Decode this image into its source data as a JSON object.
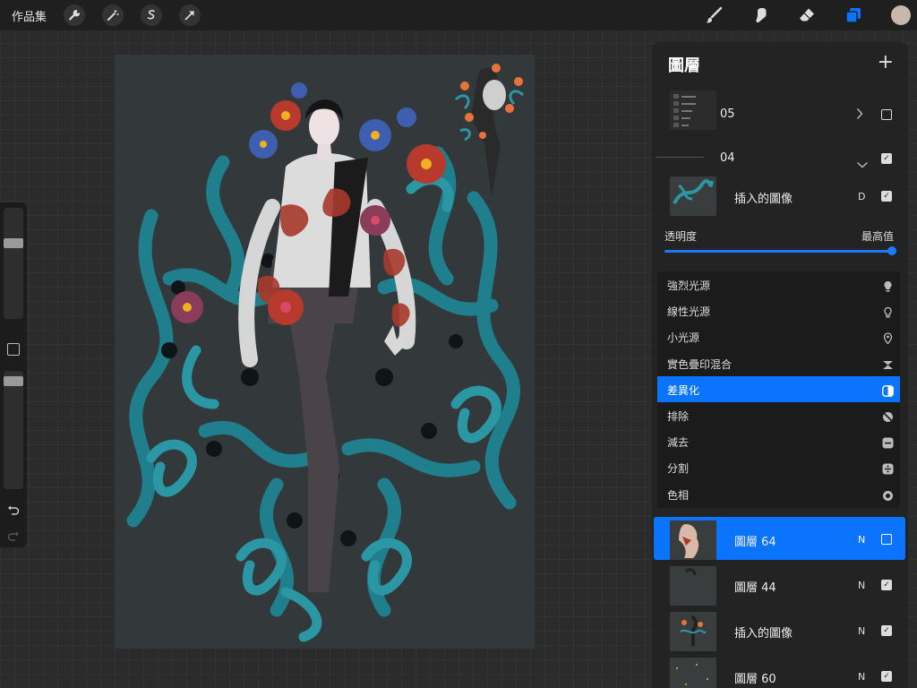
{
  "app": {
    "gallery_label": "作品集",
    "color_swatch": "#c7b7ac",
    "accent": "#0a74ff"
  },
  "top_left_tools": [
    {
      "name": "wrench-icon"
    },
    {
      "name": "magic-wand-icon"
    },
    {
      "name": "selection-icon"
    },
    {
      "name": "transform-arrow-icon"
    }
  ],
  "top_right_tools": [
    {
      "name": "brush-icon"
    },
    {
      "name": "smudge-icon"
    },
    {
      "name": "eraser-icon"
    },
    {
      "name": "layers-icon"
    }
  ],
  "sidebar": {
    "size_level": 0.3,
    "opacity_level": 0.05
  },
  "layers_panel": {
    "title": "圖層",
    "add_label": "+",
    "group_05": {
      "label": "05",
      "checked": false
    },
    "group_04": {
      "label": "04",
      "checked": true
    },
    "layer_inserted_top": {
      "label": "插入的圖像",
      "mode": "D",
      "checked": true
    },
    "opacity": {
      "label": "透明度",
      "max_label": "最高值",
      "value": 1.0
    },
    "blend_modes": [
      {
        "label": "強烈光源",
        "icon": "bulb-icon",
        "selected": false
      },
      {
        "label": "線性光源",
        "icon": "bulb-outline-icon",
        "selected": false
      },
      {
        "label": "小光源",
        "icon": "pin-light-icon",
        "selected": false
      },
      {
        "label": "實色疊印混合",
        "icon": "hard-mix-icon",
        "selected": false
      },
      {
        "label": "差異化",
        "icon": "difference-icon",
        "selected": true
      },
      {
        "label": "排除",
        "icon": "exclusion-icon",
        "selected": false
      },
      {
        "label": "減去",
        "icon": "subtract-icon",
        "selected": false
      },
      {
        "label": "分割",
        "icon": "divide-icon",
        "selected": false
      },
      {
        "label": "色相",
        "icon": "hue-icon",
        "selected": false
      }
    ],
    "layers": [
      {
        "label": "圖層 64",
        "mode": "N",
        "checked": false,
        "selected": true
      },
      {
        "label": "圖層 44",
        "mode": "N",
        "checked": true,
        "selected": false
      },
      {
        "label": "插入的圖像",
        "mode": "N",
        "checked": true,
        "selected": false
      },
      {
        "label": "圖層 60",
        "mode": "N",
        "checked": true,
        "selected": false
      }
    ]
  }
}
